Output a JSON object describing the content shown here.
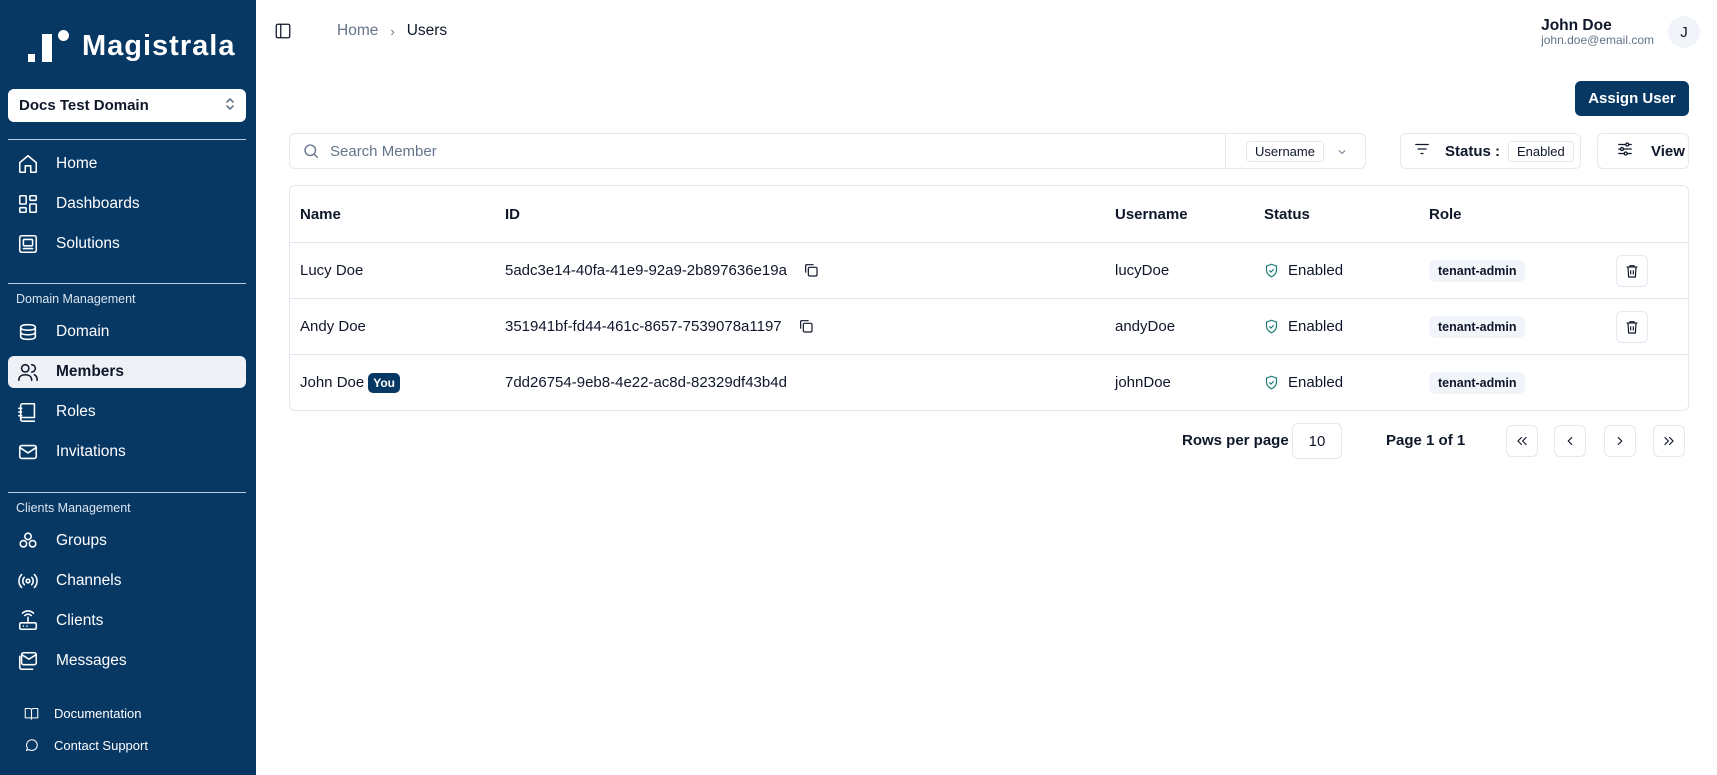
{
  "brand": {
    "name": "Magistrala"
  },
  "domain_select": {
    "value": "Docs Test Domain"
  },
  "sidebar": {
    "main_items": [
      {
        "label": "Home",
        "icon": "home-icon"
      },
      {
        "label": "Dashboards",
        "icon": "dashboard-icon"
      },
      {
        "label": "Solutions",
        "icon": "solutions-icon"
      }
    ],
    "domain_section": {
      "label": "Domain Management",
      "items": [
        {
          "label": "Domain",
          "icon": "domain-icon"
        },
        {
          "label": "Members",
          "icon": "users-icon",
          "active": true
        },
        {
          "label": "Roles",
          "icon": "roles-icon"
        },
        {
          "label": "Invitations",
          "icon": "mail-icon"
        }
      ]
    },
    "clients_section": {
      "label": "Clients Management",
      "items": [
        {
          "label": "Groups",
          "icon": "groups-icon"
        },
        {
          "label": "Channels",
          "icon": "radio-icon"
        },
        {
          "label": "Clients",
          "icon": "router-icon"
        },
        {
          "label": "Messages",
          "icon": "messages-icon"
        }
      ]
    },
    "footer_items": [
      {
        "label": "Documentation",
        "icon": "book-icon"
      },
      {
        "label": "Contact Support",
        "icon": "chat-icon"
      }
    ]
  },
  "breadcrumb": {
    "home": "Home",
    "current": "Users"
  },
  "user": {
    "name": "John Doe",
    "email": "john.doe@email.com",
    "initial": "J"
  },
  "assign_button": "Assign User",
  "search": {
    "placeholder": "Search Member",
    "field": "Username"
  },
  "status_filter": {
    "label": "Status :",
    "value": "Enabled"
  },
  "view_button": "View",
  "table": {
    "headers": {
      "name": "Name",
      "id": "ID",
      "username": "Username",
      "status": "Status",
      "role": "Role"
    },
    "rows": [
      {
        "name": "Lucy Doe",
        "id": "5adc3e14-40fa-41e9-92a9-2b897636e19a",
        "username": "lucyDoe",
        "status": "Enabled",
        "role": "tenant-admin"
      },
      {
        "name": "Andy Doe",
        "id": "351941bf-fd44-461c-8657-7539078a1197",
        "username": "andyDoe",
        "status": "Enabled",
        "role": "tenant-admin"
      },
      {
        "name": "John Doe",
        "badge": "You",
        "id": "7dd26754-9eb8-4e22-ac8d-82329df43b4d",
        "username": "johnDoe",
        "status": "Enabled",
        "role": "tenant-admin"
      }
    ]
  },
  "pagination": {
    "rows_label": "Rows per page",
    "rows_value": "10",
    "page_info": "Page 1 of 1"
  },
  "colors": {
    "sidebar_bg": "#073763",
    "accent": "#073763",
    "status_icon": "#0f766e"
  }
}
